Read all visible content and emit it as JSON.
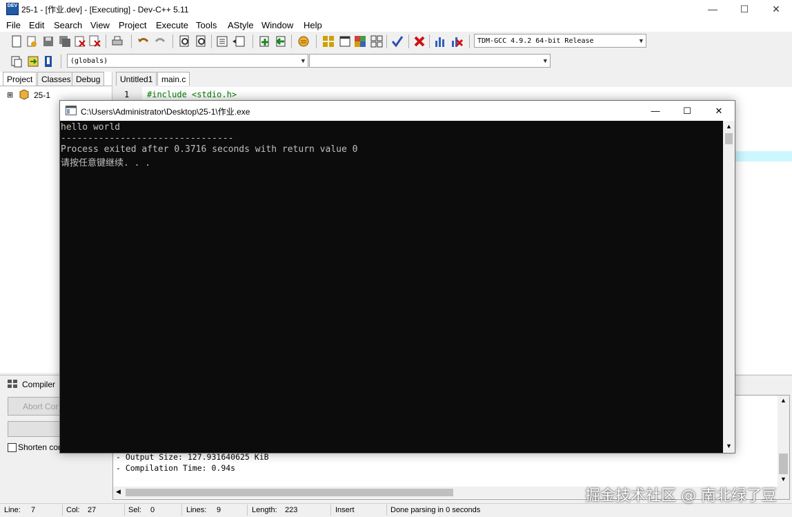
{
  "window": {
    "title": "25-1 - [作业.dev] - [Executing] - Dev-C++ 5.11",
    "app_icon_text": "DEV",
    "minimize": "—",
    "maximize": "☐",
    "close": "✕"
  },
  "menu": [
    "File",
    "Edit",
    "Search",
    "View",
    "Project",
    "Execute",
    "Tools",
    "AStyle",
    "Window",
    "Help"
  ],
  "toolbar": {
    "compiler_select": "TDM-GCC 4.9.2 64-bit Release",
    "scope_select": "(globals)",
    "member_select": ""
  },
  "left_panel": {
    "tabs": [
      "Project",
      "Classes",
      "Debug"
    ],
    "tree_root": "25-1",
    "tree_expander": "⊞"
  },
  "editor": {
    "tabs": [
      "Untitled1",
      "main.c"
    ],
    "lines": [
      {
        "number": "1",
        "code": "#include <stdio.h>"
      }
    ]
  },
  "console": {
    "title": "C:\\Users\\Administrator\\Desktop\\25-1\\作业.exe",
    "lines": [
      "hello world",
      "--------------------------------",
      "Process exited after 0.3716 seconds with return value 0",
      "请按任意键继续. . ."
    ],
    "minimize": "—",
    "maximize": "☐",
    "close": "✕"
  },
  "bottom": {
    "compiler_tab": "Compiler",
    "abort_button": "Abort Cor",
    "shorten_label": "Shorten cor",
    "log_lines": [
      "- Output Size: 127.931640625 KiB",
      "- Compilation Time: 0.94s"
    ]
  },
  "status": {
    "line_label": "Line:",
    "line_value": "7",
    "col_label": "Col:",
    "col_value": "27",
    "sel_label": "Sel:",
    "sel_value": "0",
    "lines_label": "Lines:",
    "lines_value": "9",
    "length_label": "Length:",
    "length_value": "223",
    "mode": "Insert",
    "message": "Done parsing in 0 seconds"
  },
  "watermark": "掘金技术社区 @ 南北绿了豆",
  "colors": {
    "accent": "#1e5aa8",
    "console_bg": "#0c0c0c",
    "console_fg": "#c0c0c0",
    "code_keyword": "#008000",
    "highlight_line": "#ccf7ff"
  }
}
